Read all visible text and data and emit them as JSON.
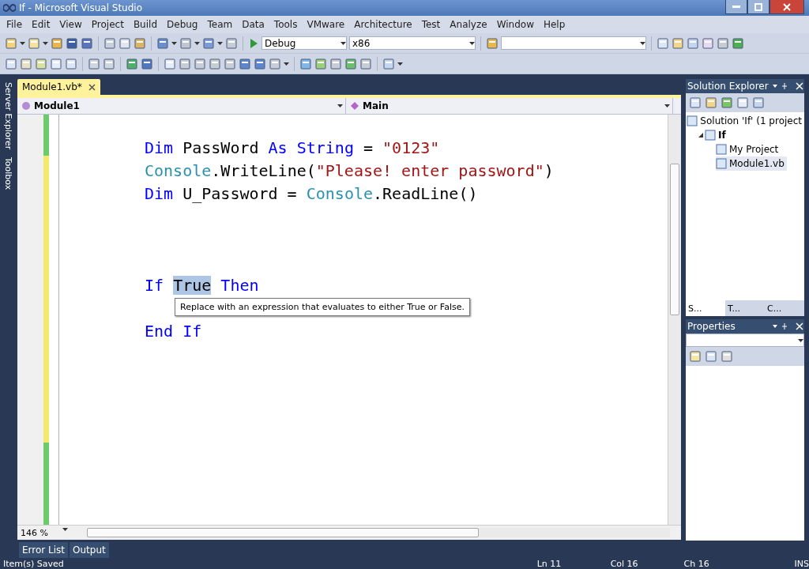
{
  "window": {
    "title": "If - Microsoft Visual Studio"
  },
  "menu": [
    "File",
    "Edit",
    "View",
    "Project",
    "Build",
    "Debug",
    "Team",
    "Data",
    "Tools",
    "VMware",
    "Architecture",
    "Test",
    "Analyze",
    "Window",
    "Help"
  ],
  "toolbar": {
    "configuration": "Debug",
    "platform": "x86"
  },
  "side_tabs": [
    "Server Explorer",
    "Toolbox"
  ],
  "document_tab": {
    "label": "Module1.vb*",
    "selected": true
  },
  "navigation": {
    "type": "Module1",
    "member": "Main"
  },
  "code_lines": [
    {
      "kind": "statement",
      "tokens": [
        {
          "kind": "keyword",
          "text": "Dim "
        },
        {
          "kind": "plain",
          "text": "PassWord "
        },
        {
          "kind": "keyword",
          "text": "As String"
        },
        {
          "kind": "plain",
          "text": " = "
        },
        {
          "kind": "string",
          "text": "\"0123\""
        }
      ]
    },
    {
      "kind": "statement",
      "tokens": [
        {
          "kind": "type",
          "text": "Console"
        },
        {
          "kind": "plain",
          "text": ".WriteLine("
        },
        {
          "kind": "string",
          "text": "\"Please! enter password\""
        },
        {
          "kind": "plain",
          "text": ")"
        }
      ]
    },
    {
      "kind": "statement",
      "tokens": [
        {
          "kind": "keyword",
          "text": "Dim "
        },
        {
          "kind": "plain",
          "text": "U_Password = "
        },
        {
          "kind": "type",
          "text": "Console"
        },
        {
          "kind": "plain",
          "text": ".ReadLine()"
        }
      ]
    },
    {
      "kind": "block_start",
      "tokens": [
        {
          "kind": "keyword",
          "text": "If "
        },
        {
          "kind": "selected",
          "text": "True"
        },
        {
          "kind": "keyword",
          "text": " Then"
        }
      ]
    },
    {
      "kind": "block_end",
      "tokens": [
        {
          "kind": "keyword",
          "text": "End If"
        }
      ]
    }
  ],
  "tooltip": "Replace with an expression that evaluates to either True or False.",
  "zoom": "146 %",
  "solution_explorer": {
    "title": "Solution Explorer",
    "tree": [
      {
        "label": "Solution 'If' (1 project",
        "selected": false,
        "children": [
          {
            "label": "If",
            "selected": false,
            "expanded": true,
            "children": [
              {
                "label": "My Project",
                "selected": false
              },
              {
                "label": "Module1.vb",
                "selected": true
              }
            ]
          }
        ]
      }
    ],
    "tabs": [
      {
        "label": "S...",
        "selected": true
      },
      {
        "label": "T...",
        "selected": false
      },
      {
        "label": "C...",
        "selected": false
      }
    ]
  },
  "properties": {
    "title": "Properties"
  },
  "bottom_tabs": [
    "Error List",
    "Output"
  ],
  "status_bar": {
    "message": "Item(s) Saved",
    "line": "Ln 11",
    "column": "Col 16",
    "char": "Ch 16",
    "mode": "INS"
  }
}
